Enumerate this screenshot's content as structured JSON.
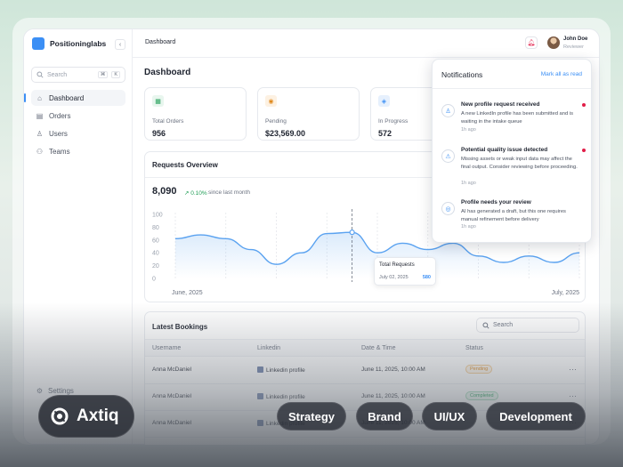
{
  "sidebar": {
    "brand": "Positioninglabs",
    "collapse_icon": "‹",
    "search_placeholder": "Search",
    "shortcut_keys": [
      "⌘",
      "K"
    ],
    "items": [
      {
        "label": "Dashboard",
        "icon": "home-icon",
        "active": true
      },
      {
        "label": "Orders",
        "icon": "clipboard-icon"
      },
      {
        "label": "Users",
        "icon": "user-icon"
      },
      {
        "label": "Teams",
        "icon": "users-icon"
      }
    ],
    "settings_label": "Settings"
  },
  "header": {
    "breadcrumb": "Dashboard",
    "user_name": "John Doe",
    "user_role": "Reviewer"
  },
  "main": {
    "title": "Dashboard",
    "stats": [
      {
        "label": "Total Orders",
        "value": "956",
        "icon": "calendar-icon",
        "color": "#1f9d55"
      },
      {
        "label": "Pending",
        "value": "$23,569.00",
        "icon": "coins-icon",
        "color": "#e08a1e"
      },
      {
        "label": "In Progress",
        "value": "572",
        "icon": "layers-icon",
        "color": "#3b8ff5"
      }
    ]
  },
  "requests": {
    "title": "Requests Overview",
    "total": "8,090",
    "delta": "↗ 0.10%",
    "delta_caption": "since last month",
    "tooltip_label": "Total Requests",
    "tooltip_date": "July 02, 2025",
    "tooltip_value": "580",
    "chart_data": {
      "type": "area",
      "x_start_label": "June, 2025",
      "x_end_label": "July, 2025",
      "yticks": [
        "100",
        "80",
        "60",
        "40",
        "20",
        "0"
      ],
      "ylim": [
        0,
        100
      ],
      "values": [
        62,
        68,
        62,
        45,
        22,
        40,
        70,
        72,
        40,
        55,
        45,
        55,
        35,
        25,
        35,
        25,
        40
      ],
      "color": "#5aa2f0",
      "grid": "vertical dashed"
    }
  },
  "bookings": {
    "title": "Latest Bookings",
    "search_placeholder": "Search",
    "columns": [
      "Username",
      "Linkedin",
      "Date & Time",
      "Status"
    ],
    "rows": [
      {
        "username": "Anna McDaniel",
        "linkedin": "Linkedin profile",
        "datetime": "June 11, 2025, 10:00 AM",
        "status": "Pending",
        "status_color": "#e08a1e"
      },
      {
        "username": "Anna McDaniel",
        "linkedin": "Linkedin profile",
        "datetime": "June 11, 2025, 10:00 AM",
        "status": "Completed",
        "status_color": "#1f9d55"
      },
      {
        "username": "Anna McDaniel",
        "linkedin": "Linkedin profile",
        "datetime": "June 11, 2025, 10:00 AM",
        "status": "",
        "status_color": "#6b7280"
      }
    ]
  },
  "notifications": {
    "title": "Notifications",
    "mark_all": "Mark all as read",
    "items": [
      {
        "title": "New profile request received",
        "body": "A new LinkedIn profile has been submitted and is waiting in the intake queue",
        "time": "1h ago",
        "unread": true,
        "icon": "user-icon"
      },
      {
        "title": "Potential quality issue detected",
        "body": "Missing assets or weak input data may affect the final output. Consider reviewing before proceeding.",
        "time": "1h ago",
        "unread": true,
        "icon": "warning-icon"
      },
      {
        "title": "Profile needs your review",
        "body": "AI has generated a draft, but this one requires manual refinement before delivery",
        "time": "1h ago",
        "unread": false,
        "icon": "user-circle-icon"
      }
    ]
  },
  "overlay": {
    "brand": "Axtiq",
    "tags": [
      "Strategy",
      "Brand",
      "UI/UX",
      "Development"
    ]
  }
}
